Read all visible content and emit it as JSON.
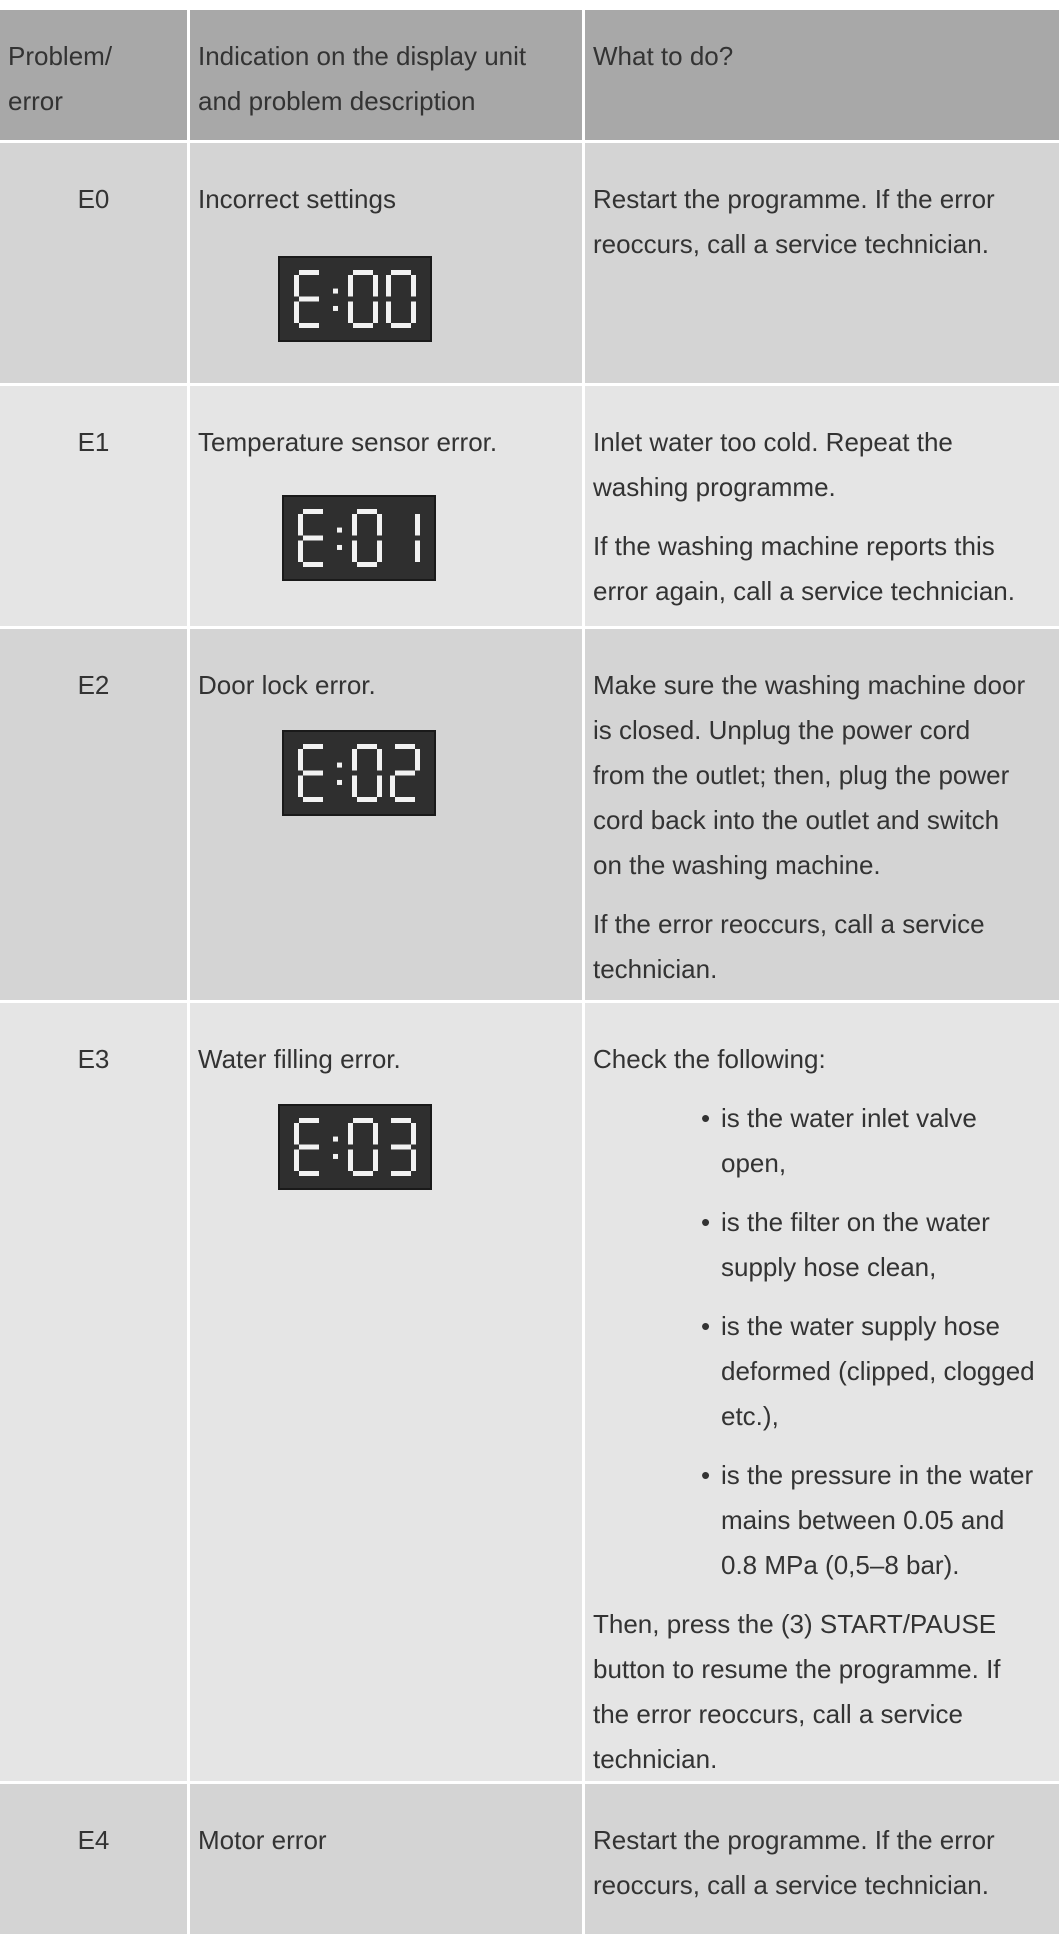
{
  "header": {
    "col1": [
      "Problem/",
      "error"
    ],
    "col2": [
      "Indication on the display unit",
      "and problem description"
    ],
    "col3": "What to do?"
  },
  "rows": [
    {
      "code": "E0",
      "description": "Incorrect settings",
      "display_text": "E:00",
      "paragraphs": [
        [
          "Restart the programme. If the error",
          "reoccurs, call a service technician."
        ]
      ]
    },
    {
      "code": "E1",
      "description": "Temperature sensor error.",
      "display_text": "E:01",
      "paragraphs": [
        [
          "Inlet water too cold. Repeat the",
          "washing programme."
        ],
        [
          "If the washing machine reports this",
          "error again, call a service technician."
        ]
      ]
    },
    {
      "code": "E2",
      "description": "Door lock error.",
      "display_text": "E:02",
      "paragraphs": [
        [
          "Make sure the washing machine door",
          "is closed. Unplug the power cord",
          "from the outlet; then, plug the power",
          "cord back into the outlet and switch",
          "on the washing machine."
        ],
        [
          "If the error reoccurs, call a service",
          "technician."
        ]
      ]
    },
    {
      "code": "E3",
      "description": "Water filling error.",
      "display_text": "E:03",
      "intro": "Check the following:",
      "bullets": [
        [
          "is the water inlet valve",
          "open,"
        ],
        [
          "is the filter on the water",
          "supply hose clean,"
        ],
        [
          "is the water supply hose",
          "deformed (clipped, clogged",
          "etc.),"
        ],
        [
          "is the pressure in the water",
          "mains between 0.05 and",
          "0.8 MPa (0,5–8 bar)."
        ]
      ],
      "outro": [
        "Then, press the (3) START/PAUSE",
        "button to resume the programme. If",
        "the error reoccurs, call a service",
        "technician."
      ]
    },
    {
      "code": "E4",
      "description": "Motor error",
      "paragraphs": [
        [
          "Restart the programme. If the error",
          "reoccurs, call a service technician."
        ]
      ]
    }
  ],
  "colors": {
    "header_bg": "#a8a8a8",
    "row_dark_bg": "#d4d4d4",
    "row_light_bg": "#e5e5e5",
    "display_bg": "#2f2f2f",
    "display_digit": "#f2f2f2"
  }
}
